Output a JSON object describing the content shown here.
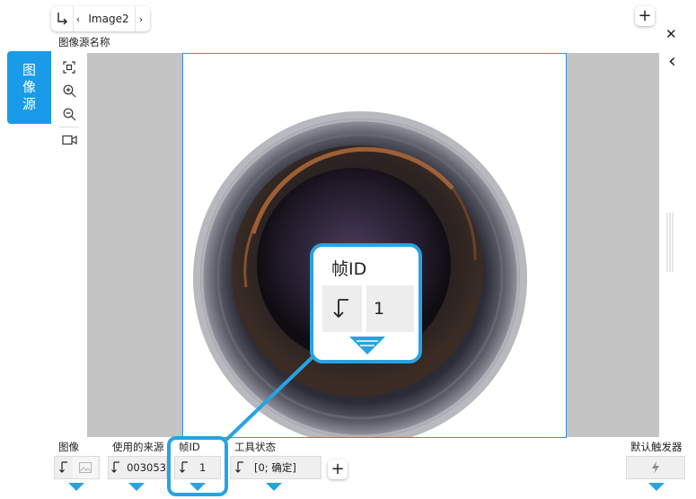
{
  "top_tab": {
    "title": "Image2",
    "prev_glyph": "‹",
    "next_glyph": "›"
  },
  "header": {
    "image_source_name_label": "图像源名称",
    "add_glyph": "+",
    "close_glyph": "✕",
    "collapse_glyph": "‹"
  },
  "side_tab": {
    "chars": [
      "图",
      "像",
      "源"
    ]
  },
  "toolbar": {
    "icons": [
      "fit-screen-icon",
      "zoom-in-icon",
      "zoom-out-icon",
      "video-camera-icon"
    ]
  },
  "callout": {
    "title": "帧ID",
    "value": "1"
  },
  "bottom": {
    "image": {
      "label": "图像"
    },
    "source": {
      "label": "使用的来源",
      "value": "003053"
    },
    "frame_id": {
      "label": "帧ID",
      "value": "1"
    },
    "tool_status": {
      "label": "工具状态",
      "value": "[0; 确定]"
    },
    "add_glyph": "+",
    "default_trigger": {
      "label": "默认触发器"
    }
  },
  "colors": {
    "accent": "#1a9be9",
    "canvas_gray": "#c4c4c4",
    "callout_border": "#27a3e4"
  }
}
